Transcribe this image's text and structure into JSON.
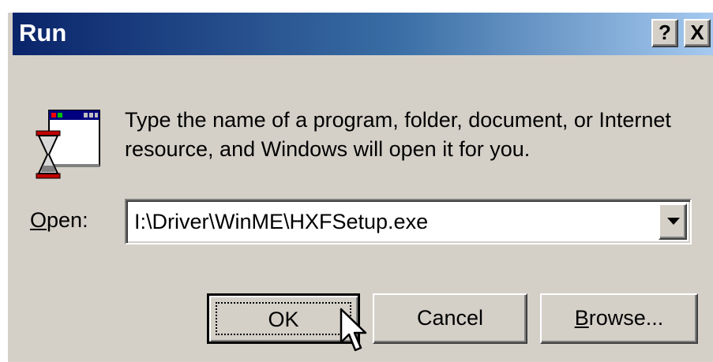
{
  "window": {
    "title": "Run",
    "help_label": "?",
    "close_label": "X"
  },
  "dialog": {
    "icon": "run-program-icon",
    "prompt": "Type the name of a program, folder, document, or Internet resource, and Windows will open it for you.",
    "open_label_accel": "O",
    "open_label_rest": "pen:",
    "open_value": "I:\\Driver\\WinME\\HXFSetup.exe"
  },
  "buttons": {
    "ok": "OK",
    "cancel": "Cancel",
    "browse_accel": "B",
    "browse_rest": "rowse..."
  },
  "colors": {
    "title_gradient_start": "#0a246a",
    "title_gradient_end": "#a6caf0",
    "face": "#d4d0c8"
  }
}
